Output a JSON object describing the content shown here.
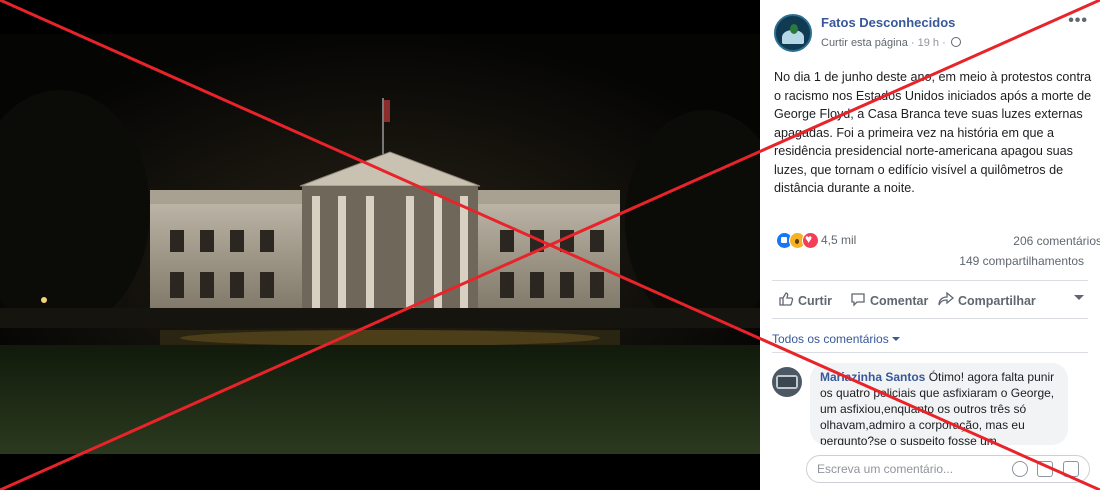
{
  "photo": {
    "alt": "",
    "sky_color": "#070605",
    "lawn_color": "#1e2716"
  },
  "post": {
    "page_name": "Fatos Desconhecidos",
    "like_page_label": "Curtir esta página",
    "separator": "·",
    "time": "19 h",
    "text": "No dia 1 de junho deste ano, em meio à protestos contra o racismo nos Estados Unidos iniciados após a morte de George Floyd, a Casa Branca teve suas luzes externas apagadas. Foi a primeira vez na história em que a residência presidencial norte-americana apagou suas luzes, que tornam o edifício visível a quilômetros de distância durante a noite."
  },
  "reactions": {
    "icons": [
      "like-icon",
      "wow-icon",
      "love-icon"
    ],
    "count": "4,5 mil",
    "comments": "206 comentários",
    "shares": "149 compartilhamentos"
  },
  "actions": {
    "like": "Curtir",
    "comment": "Comentar",
    "share": "Compartilhar"
  },
  "comments_filter": "Todos os comentários",
  "comment": {
    "author": "Mariazinha Santos",
    "text": "Ótimo! agora falta punir os quatro policiais que asfixiaram o George, um asfixiou,enquanto os outros três só olhavam,admiro a corporação, mas eu pergunto?se o suspeito fosse um"
  },
  "composer": {
    "placeholder": "Escreva um comentário..."
  },
  "overlay": {
    "x_color": "#e8232a"
  }
}
